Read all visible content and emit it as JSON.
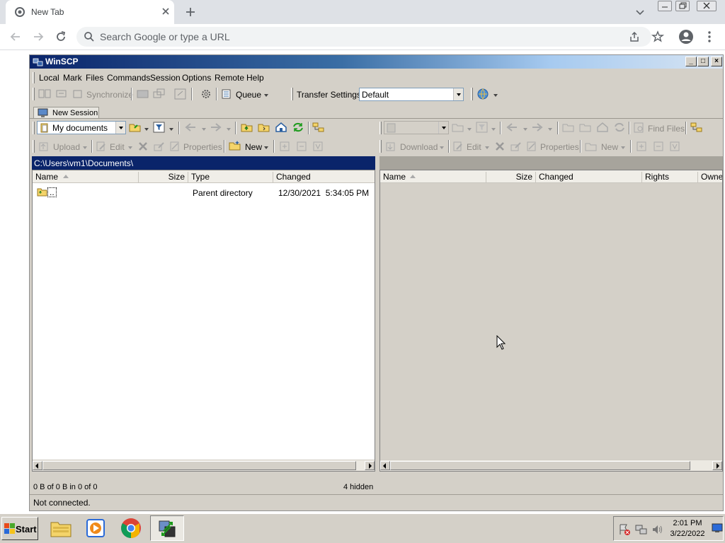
{
  "browser": {
    "tab_title": "New Tab",
    "omnibox_placeholder": "Search Google or type a URL"
  },
  "winscp": {
    "title": "WinSCP",
    "menu": [
      "Local",
      "Mark",
      "Files",
      "Commands",
      "Session",
      "Options",
      "Remote",
      "Help"
    ],
    "toolbar": {
      "synchronize": "Synchronize",
      "queue": "Queue",
      "transfer_settings_label": "Transfer Settings",
      "transfer_settings_value": "Default"
    },
    "session_tab": "New Session",
    "local": {
      "location": "My documents",
      "upload": "Upload",
      "edit": "Edit",
      "properties": "Properties",
      "new": "New",
      "path": "C:\\Users\\vm1\\Documents\\",
      "columns": [
        "Name",
        "Size",
        "Type",
        "Changed"
      ],
      "rows": [
        {
          "name": "..",
          "size": "",
          "type": "Parent directory",
          "changed": "12/30/2021  5:34:05 PM"
        }
      ],
      "status": "0 B of 0 B in 0 of 0",
      "hidden": "4 hidden"
    },
    "remote": {
      "find_files": "Find Files",
      "download": "Download",
      "edit": "Edit",
      "properties": "Properties",
      "new": "New",
      "path": "",
      "columns": [
        "Name",
        "Size",
        "Changed",
        "Rights",
        "Owne"
      ]
    },
    "connection_status": "Not connected."
  },
  "taskbar": {
    "start": "Start",
    "time": "2:01 PM",
    "date": "3/22/2022"
  },
  "colors": {
    "active_path_bg": "#0a246a",
    "inactive_path_bg": "#a7a49c",
    "window_face": "#d4d0c8"
  }
}
